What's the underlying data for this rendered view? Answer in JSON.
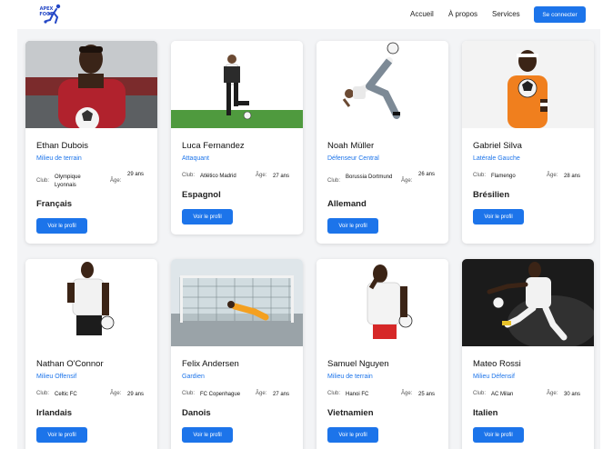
{
  "logo": {
    "line1": "APEX",
    "line2": "FOOT"
  },
  "nav": {
    "home": "Accueil",
    "about": "À propos",
    "services": "Services",
    "login": "Se connecter"
  },
  "labels": {
    "club": "Club:",
    "age": "Âge:",
    "view_profile": "Voir le profil"
  },
  "players": [
    {
      "name": "Ethan Dubois",
      "position": "Milieu de terrain",
      "club": "Olympique Lyonnais",
      "age": "29 ans",
      "nationality": "Français"
    },
    {
      "name": "Luca Fernandez",
      "position": "Attaquant",
      "club": "Atlético Madrid",
      "age": "27 ans",
      "nationality": "Espagnol"
    },
    {
      "name": "Noah Müller",
      "position": "Défenseur Central",
      "club": "Borussia Dortmund",
      "age": "26 ans",
      "nationality": "Allemand"
    },
    {
      "name": "Gabriel Silva",
      "position": "Latérale Gauche",
      "club": "Flamengo",
      "age": "28 ans",
      "nationality": "Brésilien"
    },
    {
      "name": "Nathan O'Connor",
      "position": "Milieu Offensif",
      "club": "Celtic FC",
      "age": "29 ans",
      "nationality": "Irlandais"
    },
    {
      "name": "Felix Andersen",
      "position": "Gardien",
      "club": "FC Copenhague",
      "age": "27 ans",
      "nationality": "Danois"
    },
    {
      "name": "Samuel Nguyen",
      "position": "Milieu de terrain",
      "club": "Hanoi FC",
      "age": "25 ans",
      "nationality": "Vietnamien"
    },
    {
      "name": "Mateo Rossi",
      "position": "Milieu Défensif",
      "club": "AC Milan",
      "age": "30 ans",
      "nationality": "Italien"
    }
  ],
  "colors": {
    "accent": "#1c74ea",
    "background": "#f3f4f6"
  }
}
